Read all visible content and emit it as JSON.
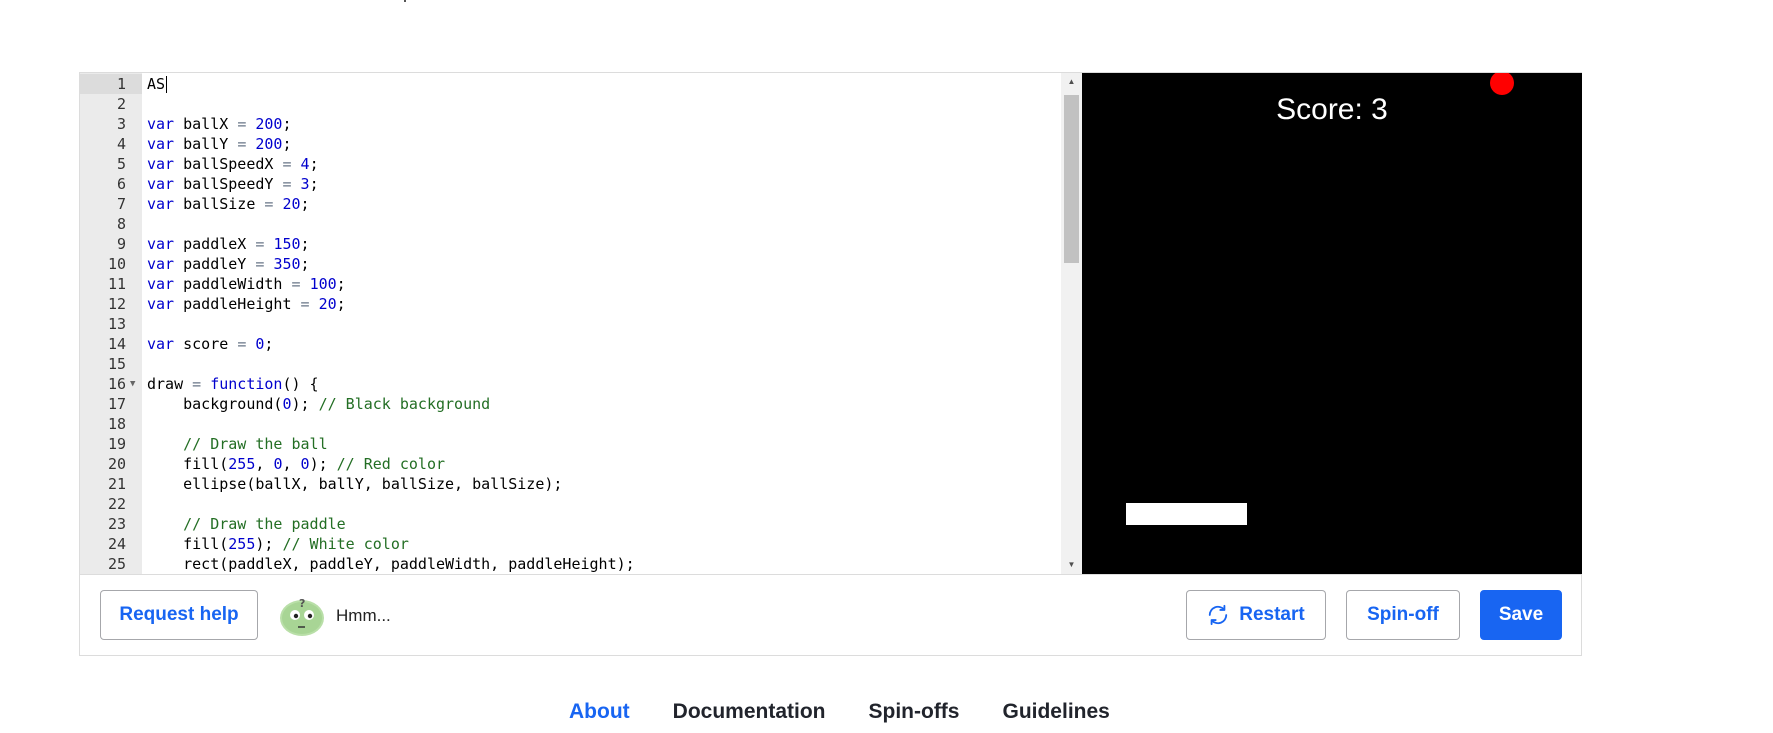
{
  "editor": {
    "lines": [
      {
        "n": "1",
        "parts": [
          {
            "t": "AS",
            "c": "plain"
          }
        ],
        "cursor": true
      },
      {
        "n": "2",
        "parts": []
      },
      {
        "n": "3",
        "parts": [
          {
            "t": "var",
            "c": "kw"
          },
          {
            "t": " ballX ",
            "c": "plain"
          },
          {
            "t": "=",
            "c": "op"
          },
          {
            "t": " ",
            "c": "plain"
          },
          {
            "t": "200",
            "c": "num"
          },
          {
            "t": ";",
            "c": "plain"
          }
        ]
      },
      {
        "n": "4",
        "parts": [
          {
            "t": "var",
            "c": "kw"
          },
          {
            "t": " ballY ",
            "c": "plain"
          },
          {
            "t": "=",
            "c": "op"
          },
          {
            "t": " ",
            "c": "plain"
          },
          {
            "t": "200",
            "c": "num"
          },
          {
            "t": ";",
            "c": "plain"
          }
        ]
      },
      {
        "n": "5",
        "parts": [
          {
            "t": "var",
            "c": "kw"
          },
          {
            "t": " ballSpeedX ",
            "c": "plain"
          },
          {
            "t": "=",
            "c": "op"
          },
          {
            "t": " ",
            "c": "plain"
          },
          {
            "t": "4",
            "c": "num"
          },
          {
            "t": ";",
            "c": "plain"
          }
        ]
      },
      {
        "n": "6",
        "parts": [
          {
            "t": "var",
            "c": "kw"
          },
          {
            "t": " ballSpeedY ",
            "c": "plain"
          },
          {
            "t": "=",
            "c": "op"
          },
          {
            "t": " ",
            "c": "plain"
          },
          {
            "t": "3",
            "c": "num"
          },
          {
            "t": ";",
            "c": "plain"
          }
        ]
      },
      {
        "n": "7",
        "parts": [
          {
            "t": "var",
            "c": "kw"
          },
          {
            "t": " ballSize ",
            "c": "plain"
          },
          {
            "t": "=",
            "c": "op"
          },
          {
            "t": " ",
            "c": "plain"
          },
          {
            "t": "20",
            "c": "num"
          },
          {
            "t": ";",
            "c": "plain"
          }
        ]
      },
      {
        "n": "8",
        "parts": []
      },
      {
        "n": "9",
        "parts": [
          {
            "t": "var",
            "c": "kw"
          },
          {
            "t": " paddleX ",
            "c": "plain"
          },
          {
            "t": "=",
            "c": "op"
          },
          {
            "t": " ",
            "c": "plain"
          },
          {
            "t": "150",
            "c": "num"
          },
          {
            "t": ";",
            "c": "plain"
          }
        ]
      },
      {
        "n": "10",
        "parts": [
          {
            "t": "var",
            "c": "kw"
          },
          {
            "t": " paddleY ",
            "c": "plain"
          },
          {
            "t": "=",
            "c": "op"
          },
          {
            "t": " ",
            "c": "plain"
          },
          {
            "t": "350",
            "c": "num"
          },
          {
            "t": ";",
            "c": "plain"
          }
        ]
      },
      {
        "n": "11",
        "parts": [
          {
            "t": "var",
            "c": "kw"
          },
          {
            "t": " paddleWidth ",
            "c": "plain"
          },
          {
            "t": "=",
            "c": "op"
          },
          {
            "t": " ",
            "c": "plain"
          },
          {
            "t": "100",
            "c": "num"
          },
          {
            "t": ";",
            "c": "plain"
          }
        ]
      },
      {
        "n": "12",
        "parts": [
          {
            "t": "var",
            "c": "kw"
          },
          {
            "t": " paddleHeight ",
            "c": "plain"
          },
          {
            "t": "=",
            "c": "op"
          },
          {
            "t": " ",
            "c": "plain"
          },
          {
            "t": "20",
            "c": "num"
          },
          {
            "t": ";",
            "c": "plain"
          }
        ]
      },
      {
        "n": "13",
        "parts": []
      },
      {
        "n": "14",
        "parts": [
          {
            "t": "var",
            "c": "kw"
          },
          {
            "t": " score ",
            "c": "plain"
          },
          {
            "t": "=",
            "c": "op"
          },
          {
            "t": " ",
            "c": "plain"
          },
          {
            "t": "0",
            "c": "num"
          },
          {
            "t": ";",
            "c": "plain"
          }
        ]
      },
      {
        "n": "15",
        "parts": []
      },
      {
        "n": "16",
        "fold": true,
        "parts": [
          {
            "t": "draw ",
            "c": "plain"
          },
          {
            "t": "=",
            "c": "op"
          },
          {
            "t": " ",
            "c": "plain"
          },
          {
            "t": "function",
            "c": "kw"
          },
          {
            "t": "() {",
            "c": "plain"
          }
        ]
      },
      {
        "n": "17",
        "parts": [
          {
            "t": "    background(",
            "c": "plain"
          },
          {
            "t": "0",
            "c": "num"
          },
          {
            "t": "); ",
            "c": "plain"
          },
          {
            "t": "// Black background",
            "c": "cm"
          }
        ]
      },
      {
        "n": "18",
        "parts": []
      },
      {
        "n": "19",
        "parts": [
          {
            "t": "    ",
            "c": "plain"
          },
          {
            "t": "// Draw the ball",
            "c": "cm"
          }
        ]
      },
      {
        "n": "20",
        "parts": [
          {
            "t": "    fill(",
            "c": "plain"
          },
          {
            "t": "255",
            "c": "num"
          },
          {
            "t": ", ",
            "c": "plain"
          },
          {
            "t": "0",
            "c": "num"
          },
          {
            "t": ", ",
            "c": "plain"
          },
          {
            "t": "0",
            "c": "num"
          },
          {
            "t": "); ",
            "c": "plain"
          },
          {
            "t": "// Red color",
            "c": "cm"
          }
        ]
      },
      {
        "n": "21",
        "parts": [
          {
            "t": "    ellipse(ballX, ballY, ballSize, ballSize);",
            "c": "plain"
          }
        ]
      },
      {
        "n": "22",
        "parts": []
      },
      {
        "n": "23",
        "parts": [
          {
            "t": "    ",
            "c": "plain"
          },
          {
            "t": "// Draw the paddle",
            "c": "cm"
          }
        ]
      },
      {
        "n": "24",
        "parts": [
          {
            "t": "    fill(",
            "c": "plain"
          },
          {
            "t": "255",
            "c": "num"
          },
          {
            "t": "); ",
            "c": "plain"
          },
          {
            "t": "// White color",
            "c": "cm"
          }
        ]
      },
      {
        "n": "25",
        "parts": [
          {
            "t": "    rect(paddleX, paddleY, paddleWidth, paddleHeight);",
            "c": "plain"
          }
        ]
      }
    ]
  },
  "canvas": {
    "score_text": "Score: 3",
    "background_color": "#000000",
    "ball_color": "#ff0000",
    "paddle_color": "#ffffff"
  },
  "toolbar": {
    "help_label": "Request help",
    "status_text": "Hmm...",
    "restart_label": "Restart",
    "spinoff_label": "Spin-off",
    "save_label": "Save",
    "restart_icon": "refresh-icon",
    "avatar_icon": "thinking-avatar-icon"
  },
  "nav": {
    "about": "About",
    "documentation": "Documentation",
    "spinoffs": "Spin-offs",
    "guidelines": "Guidelines"
  },
  "colors": {
    "accent": "#1865f2",
    "keyword": "#0000cd",
    "number": "#0000cd",
    "comment": "#236e24",
    "operator": "#687687"
  }
}
